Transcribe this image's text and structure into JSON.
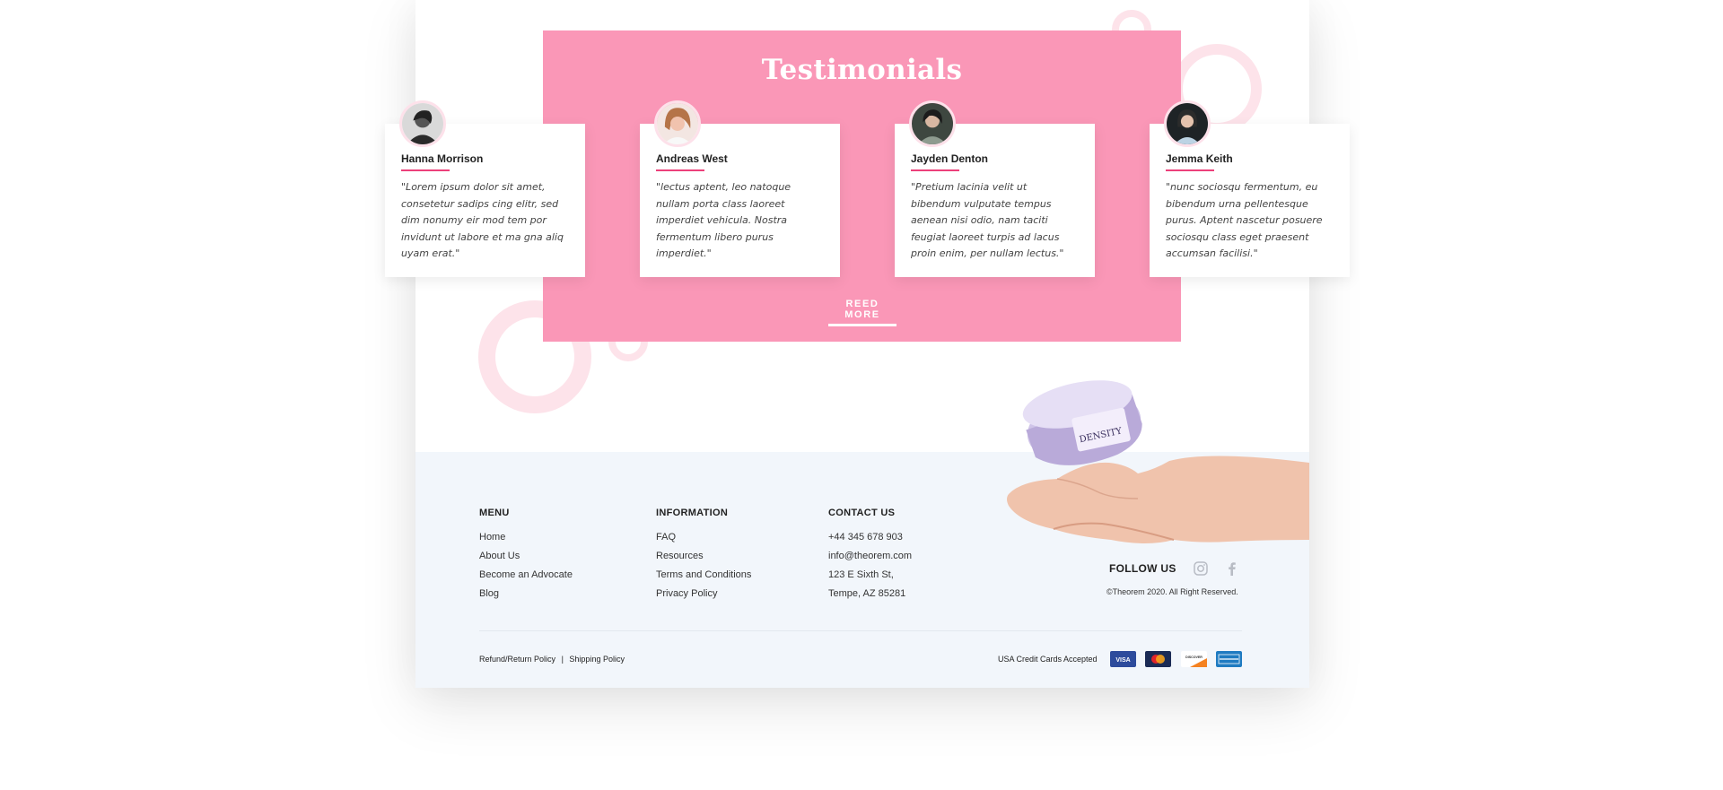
{
  "testimonials": {
    "title": "Testimonials",
    "read_more": "REED MORE",
    "items": [
      {
        "name": "Hanna Morrison",
        "quote": "\"Lorem ipsum dolor sit amet, consetetur sadips cing elitr, sed dim nonumy eir mod tem por invidunt ut labore et ma gna aliq uyam erat.\""
      },
      {
        "name": "Andreas West",
        "quote": "\"lectus aptent, leo natoque nullam porta class laoreet imperdiet vehicula. Nostra fermentum libero purus imperdiet.\""
      },
      {
        "name": "Jayden Denton",
        "quote": "\"Pretium lacinia velit ut bibendum vulputate tempus aenean nisi odio, nam taciti feugiat laoreet turpis ad lacus proin enim, per nullam lectus.\""
      },
      {
        "name": "Jemma Keith",
        "quote": "\"nunc sociosqu fermentum, eu bibendum urna pellentesque purus. Aptent nascetur posuere sociosqu class eget praesent accumsan facilisi.\""
      }
    ]
  },
  "product": {
    "label": "DENSITY"
  },
  "footer": {
    "menu": {
      "title": "MENU",
      "links": [
        "Home",
        "About Us",
        "Become an Advocate",
        "Blog"
      ]
    },
    "information": {
      "title": "INFORMATION",
      "links": [
        "FAQ",
        "Resources",
        "Terms and Conditions",
        "Privacy Policy"
      ]
    },
    "contact": {
      "title": "CONTACT US",
      "lines": [
        "+44 345 678 903",
        "info@theorem.com",
        "123 E Sixth St,",
        "Tempe, AZ 85281"
      ]
    },
    "follow_us": "FOLLOW US",
    "copyright": "©Theorem 2020. All Right Reserved.",
    "policy_links": [
      "Refund/Return Policy",
      "|",
      "Shipping Policy"
    ],
    "cards_accepted": "USA Credit Cards Accepted",
    "payment_cards": [
      "VISA",
      "Mastercard",
      "DISCOVER",
      "AMERICAN EXPRESS"
    ]
  },
  "colors": {
    "pink_panel": "#fa97b7",
    "accent": "#ec407a",
    "footer_bg": "#f2f6fb",
    "ring": "#fde3ea"
  },
  "icons": {
    "social": [
      "instagram-icon",
      "facebook-icon"
    ]
  }
}
